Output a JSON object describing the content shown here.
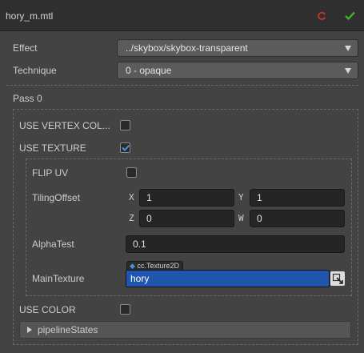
{
  "header": {
    "title": "hory_m.mtl",
    "revert_icon": "revert-icon",
    "apply_icon": "check-icon",
    "revert_color": "#c0392b",
    "apply_color": "#3fae2a"
  },
  "effect": {
    "label": "Effect",
    "value": "../skybox/skybox-transparent"
  },
  "technique": {
    "label": "Technique",
    "value": "0 - opaque"
  },
  "pass": {
    "label": "Pass 0",
    "use_vertex_color": {
      "label": "USE VERTEX COL...",
      "checked": false
    },
    "use_texture": {
      "label": "USE TEXTURE",
      "checked": true
    },
    "texture_group": {
      "flip_uv": {
        "label": "FLIP UV",
        "checked": false
      },
      "tiling_offset": {
        "label": "TilingOffset",
        "x_label": "X",
        "x_value": "1",
        "y_label": "Y",
        "y_value": "1",
        "z_label": "Z",
        "z_value": "0",
        "w_label": "W",
        "w_value": "0"
      },
      "alpha_test": {
        "label": "AlphaTest",
        "value": "0.1"
      },
      "main_texture": {
        "label": "MainTexture",
        "type": "cc.Texture2D",
        "value": "hory"
      }
    },
    "use_color": {
      "label": "USE COLOR",
      "checked": false
    },
    "pipeline_states": {
      "label": "pipelineStates"
    }
  },
  "colors": {
    "accent": "#1f55ad",
    "check": "#4a90e2"
  }
}
